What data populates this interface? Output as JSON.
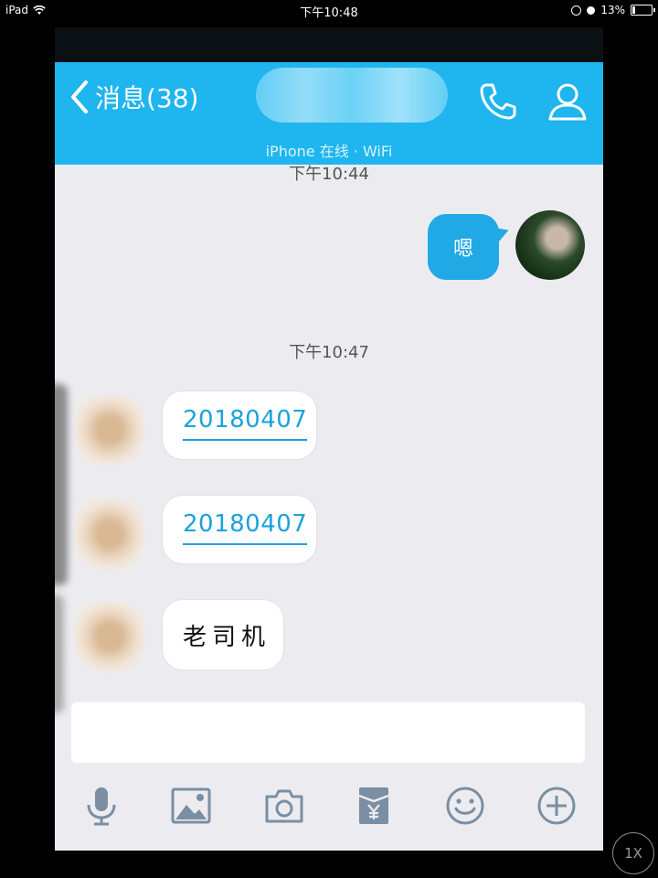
{
  "status_bar": {
    "device": "iPad",
    "time": "下午10:48",
    "battery": "13%",
    "battery_level": 0.13
  },
  "header": {
    "back_label": "消息(38)",
    "subtitle": "iPhone  在线 · WiFi"
  },
  "messages": [
    {
      "type": "timestamp",
      "text": "下午10:44"
    },
    {
      "type": "outgoing",
      "text": "嗯"
    },
    {
      "type": "timestamp",
      "text": "下午10:47"
    },
    {
      "type": "incoming",
      "text": "20180407",
      "style": "link"
    },
    {
      "type": "incoming",
      "text": "20180407",
      "style": "link"
    },
    {
      "type": "incoming",
      "text": "老司机",
      "style": "plain"
    }
  ],
  "toolbar": {
    "icons": [
      "microphone-icon",
      "image-icon",
      "camera-icon",
      "red-packet-icon",
      "emoji-icon",
      "plus-icon"
    ]
  },
  "zoom_badge": "1X",
  "colors": {
    "accent": "#1fb5ee",
    "outgoing_bubble": "#21a9e6",
    "link": "#1ba3d9",
    "background": "#ececf0"
  }
}
